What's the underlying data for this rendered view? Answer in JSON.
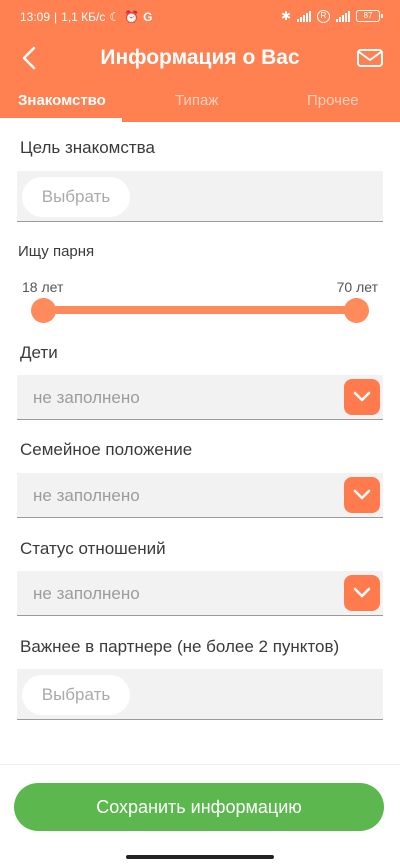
{
  "status_bar": {
    "time": "13:09",
    "speed": "1,1 КБ/с",
    "network": "4G",
    "battery": "87"
  },
  "header": {
    "title": "Информация о Вас",
    "tabs": [
      {
        "label": "Знакомство",
        "active": true
      },
      {
        "label": "Типаж",
        "active": false
      },
      {
        "label": "Прочее",
        "active": false
      }
    ]
  },
  "form": {
    "goal": {
      "label": "Цель знакомства",
      "button": "Выбрать"
    },
    "seeking": {
      "label": "Ищу парня",
      "min_label": "18 лет",
      "max_label": "70 лет",
      "min": 18,
      "max": 70
    },
    "children": {
      "label": "Дети",
      "value": "не заполнено"
    },
    "marital": {
      "label": "Семейное положение",
      "value": "не заполнено"
    },
    "relationship": {
      "label": "Статус отношений",
      "value": "не заполнено"
    },
    "partner": {
      "label": "Важнее в партнере (не более 2 пунктов)",
      "button": "Выбрать"
    }
  },
  "save_button": "Сохранить информацию",
  "colors": {
    "accent": "#ff8050",
    "save": "#5cb84e"
  }
}
